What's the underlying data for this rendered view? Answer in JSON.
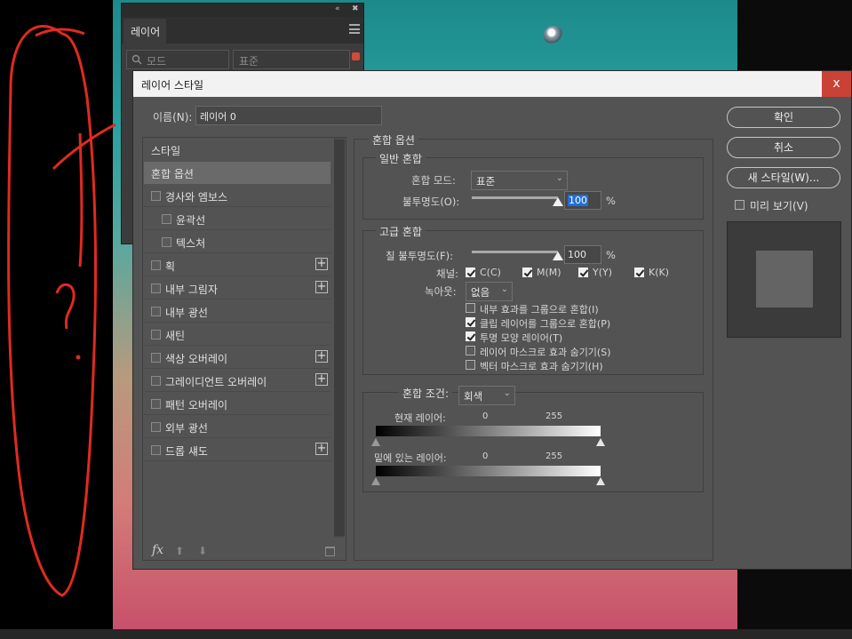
{
  "layers_panel": {
    "collapse": "«",
    "close": "✖",
    "tab": "레이어",
    "filter_placeholder": "모드",
    "blend_mode": "표준"
  },
  "dialog": {
    "title": "레이어 스타일",
    "close": "x",
    "name_label": "이름(N):",
    "name_value": "레이어 0"
  },
  "styles": {
    "items": [
      {
        "label": "스타일",
        "checkbox": false,
        "plus": false,
        "indent": 0,
        "selected": false,
        "header": true
      },
      {
        "label": "혼합 옵션",
        "checkbox": false,
        "plus": false,
        "indent": 0,
        "selected": true,
        "header": true
      },
      {
        "label": "경사와 엠보스",
        "checkbox": true,
        "plus": false,
        "indent": 0,
        "selected": false
      },
      {
        "label": "윤곽선",
        "checkbox": true,
        "plus": false,
        "indent": 1,
        "selected": false
      },
      {
        "label": "텍스처",
        "checkbox": true,
        "plus": false,
        "indent": 1,
        "selected": false
      },
      {
        "label": "획",
        "checkbox": true,
        "plus": true,
        "indent": 0,
        "selected": false
      },
      {
        "label": "내부 그림자",
        "checkbox": true,
        "plus": true,
        "indent": 0,
        "selected": false
      },
      {
        "label": "내부 광선",
        "checkbox": true,
        "plus": false,
        "indent": 0,
        "selected": false
      },
      {
        "label": "새틴",
        "checkbox": true,
        "plus": false,
        "indent": 0,
        "selected": false
      },
      {
        "label": "색상 오버레이",
        "checkbox": true,
        "plus": true,
        "indent": 0,
        "selected": false
      },
      {
        "label": "그레이디언트 오버레이",
        "checkbox": true,
        "plus": true,
        "indent": 0,
        "selected": false
      },
      {
        "label": "패턴 오버레이",
        "checkbox": true,
        "plus": false,
        "indent": 0,
        "selected": false
      },
      {
        "label": "외부 광선",
        "checkbox": true,
        "plus": false,
        "indent": 0,
        "selected": false
      },
      {
        "label": "드롭 섀도",
        "checkbox": true,
        "plus": true,
        "indent": 0,
        "selected": false
      }
    ],
    "plus_symbol": "+",
    "fx_label": "fx",
    "up": "⬆",
    "down": "⬇"
  },
  "blend_options": {
    "title": "혼합 옵션",
    "general": {
      "title": "일반 혼합",
      "mode_label": "혼합 모드:",
      "mode_value": "표준",
      "opacity_label": "불투명도(O):",
      "opacity_value": "100",
      "opacity_fraction": 1.0,
      "percent": "%"
    },
    "advanced": {
      "title": "고급 혼합",
      "fill_label": "칠 불투명도(F):",
      "fill_value": "100",
      "fill_fraction": 1.0,
      "percent": "%",
      "channels_label": "채널:",
      "channels": [
        {
          "label": "C(C)",
          "checked": true
        },
        {
          "label": "M(M)",
          "checked": true
        },
        {
          "label": "Y(Y)",
          "checked": true
        },
        {
          "label": "K(K)",
          "checked": true
        }
      ],
      "knockout_label": "녹아웃:",
      "knockout_value": "없음",
      "options": [
        {
          "label": "내부 효과를 그룹으로 혼합(I)",
          "checked": false
        },
        {
          "label": "클립 레이어를 그룹으로 혼합(P)",
          "checked": true
        },
        {
          "label": "투명 모양 레이어(T)",
          "checked": true
        },
        {
          "label": "레이어 마스크로 효과 숨기기(S)",
          "checked": false
        },
        {
          "label": "벡터 마스크로 효과 숨기기(H)",
          "checked": false
        }
      ]
    },
    "blend_if": {
      "label": "혼합 조건:",
      "value": "회색",
      "current_layer_label": "현재 레이어:",
      "underlying_label": "밑에 있는 레이어:",
      "min": "0",
      "max": "255"
    }
  },
  "buttons": {
    "ok": "확인",
    "cancel": "취소",
    "new_style": "새 스타일(W)...",
    "preview_label": "미리 보기(V)",
    "preview_checked": false
  }
}
